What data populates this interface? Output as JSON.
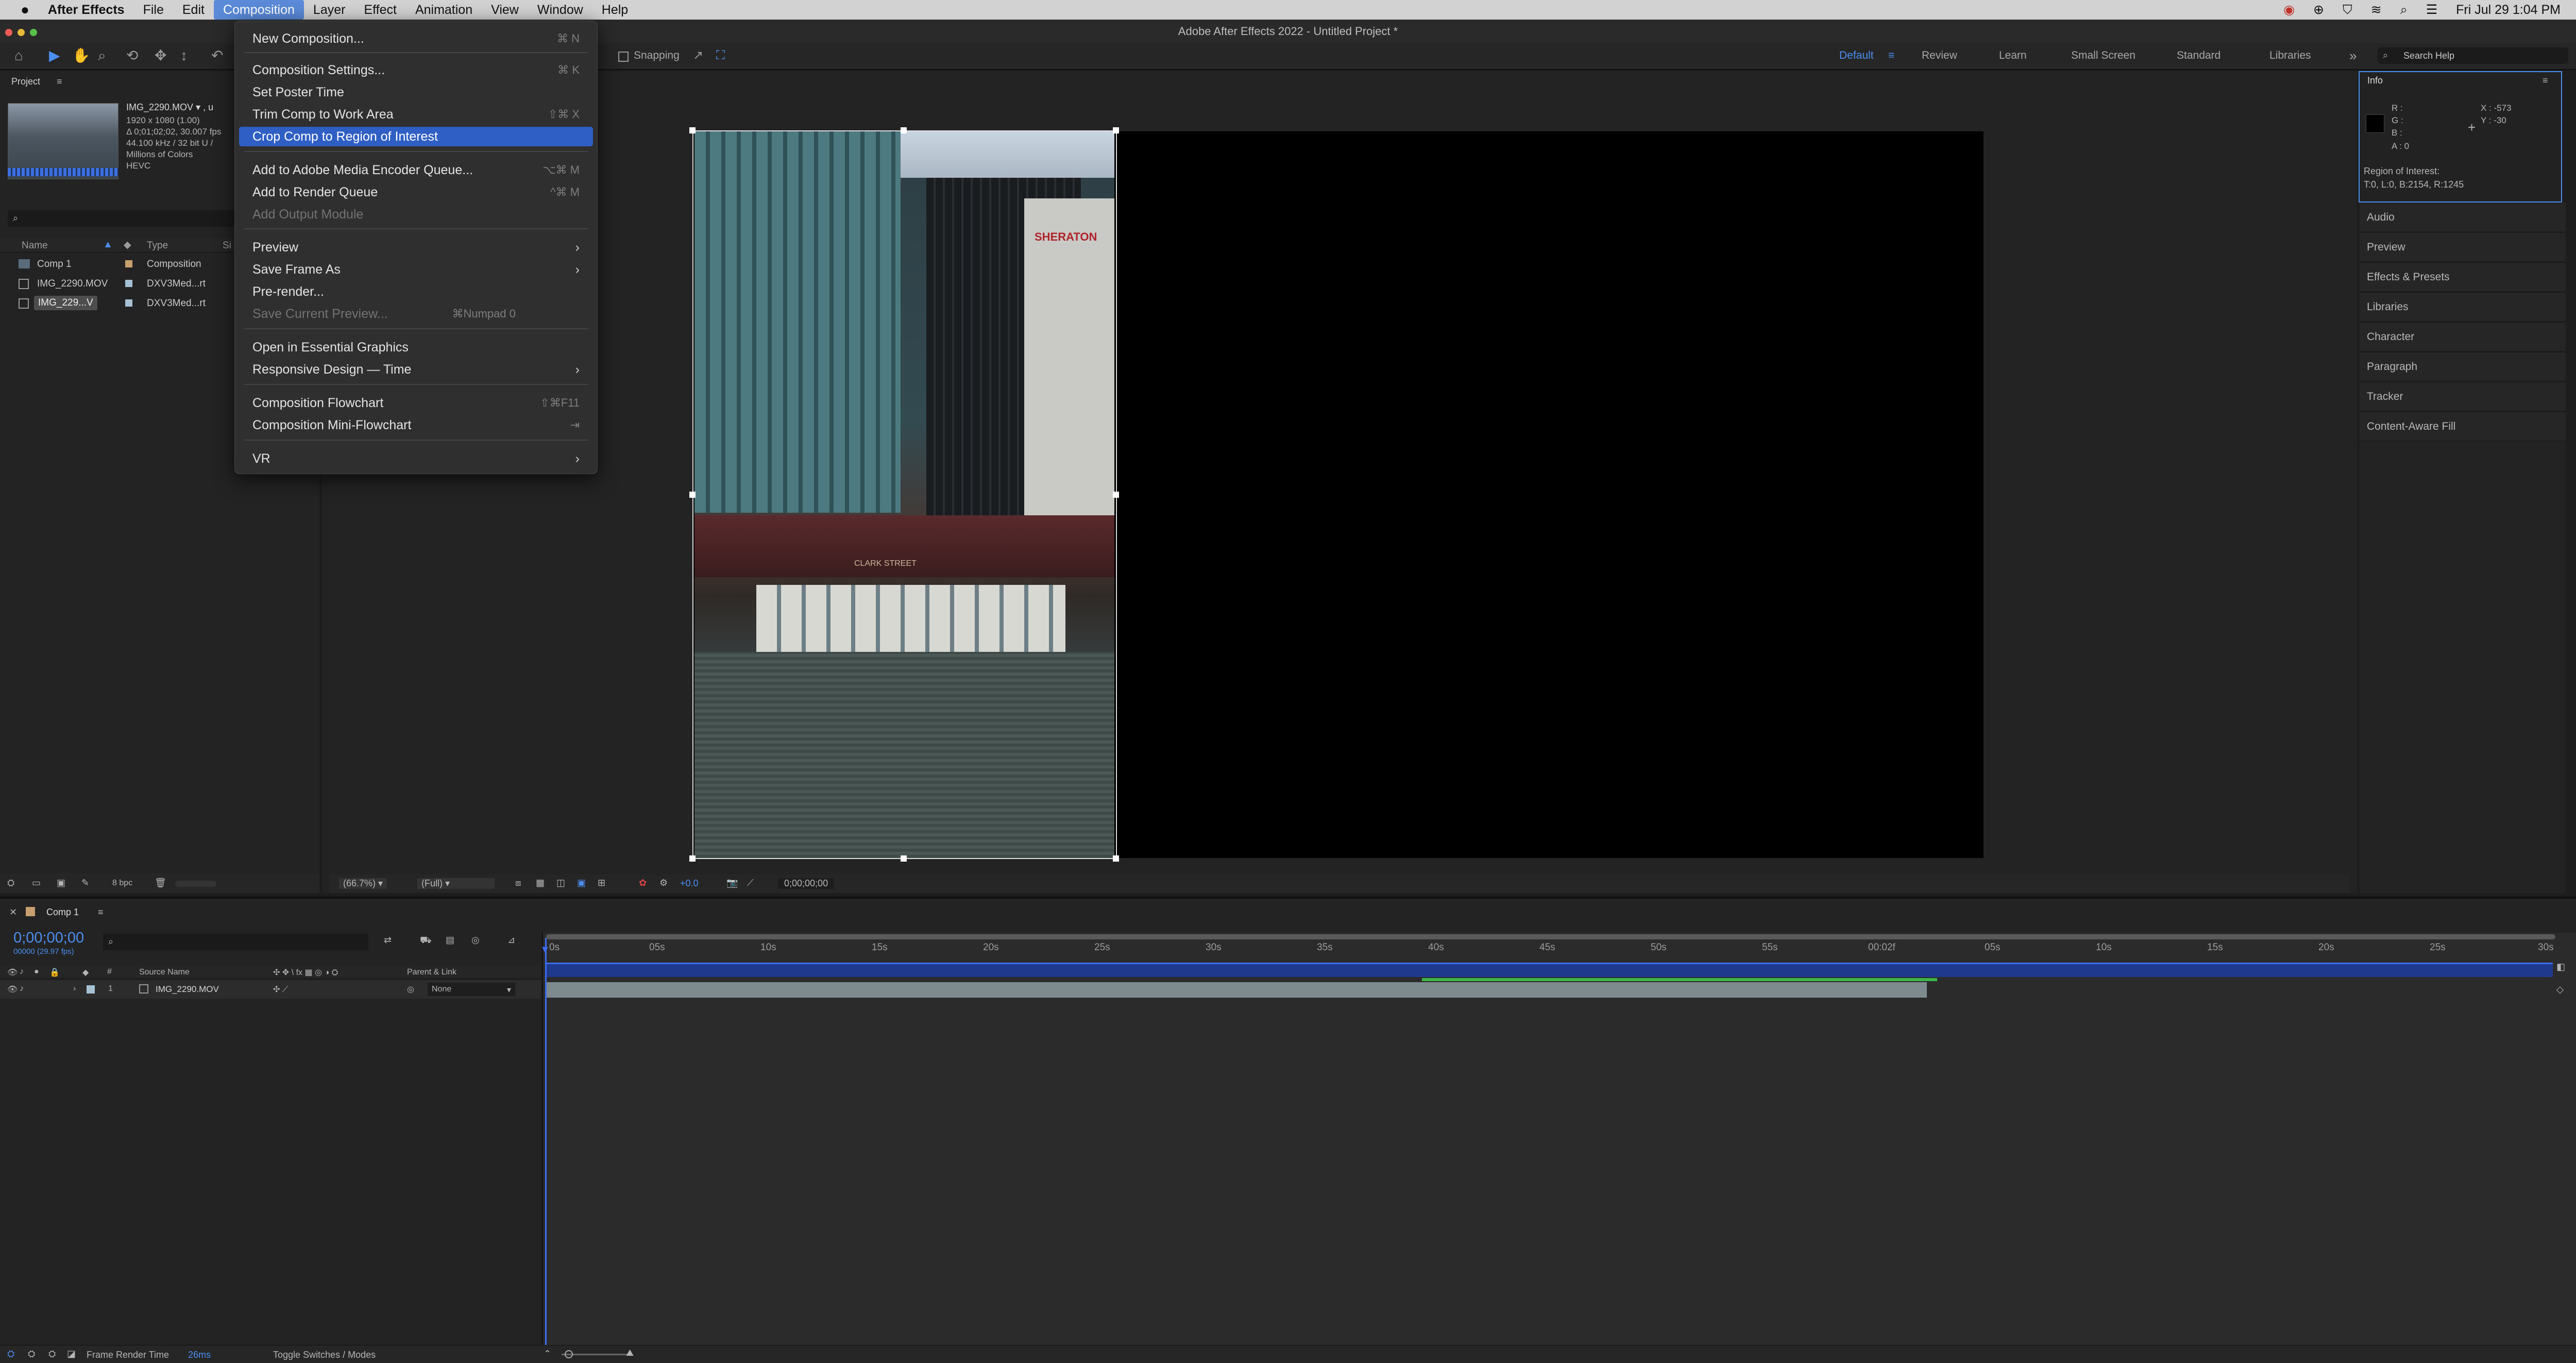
{
  "menubar": {
    "apple": "",
    "app": "After Effects",
    "items": [
      "File",
      "Edit",
      "Composition",
      "Layer",
      "Effect",
      "Animation",
      "View",
      "Window",
      "Help"
    ],
    "clock": "Fri Jul 29  1:04 PM"
  },
  "window": {
    "title": "Adobe After Effects 2022 - Untitled Project *"
  },
  "toolbar": {
    "snapping": "Snapping",
    "workspaces": [
      "Default",
      "Review",
      "Learn",
      "Small Screen",
      "Standard",
      "Libraries"
    ],
    "search_placeholder": "Search Help"
  },
  "project": {
    "title": "Project",
    "file_name": "IMG_2290.MOV ▾ , u",
    "info": [
      "1920 x 1080 (1.00)",
      "Δ 0;01;02;02, 30.007 fps",
      "HEVC",
      "Millions of Colors",
      "44.100 kHz / 32 bit U /"
    ],
    "columns": {
      "name": "Name",
      "type": "Type",
      "size": "Si"
    },
    "rows": [
      {
        "name": "Comp 1",
        "type": "Composition"
      },
      {
        "name": "IMG_2290.MOV",
        "type": "DXV3Med...rt"
      },
      {
        "name": "IMG_229...V",
        "type": "DXV3Med...rt"
      }
    ],
    "bpc": "8 bpc"
  },
  "menu": {
    "items": [
      {
        "label": "New Composition...",
        "shortcut": "⌘ N"
      },
      {
        "label": "Composition Settings...",
        "shortcut": "⌘ K"
      },
      {
        "label": "Set Poster Time",
        "shortcut": ""
      },
      {
        "label": "Trim Comp to Work Area",
        "shortcut": "⇧⌘ X"
      },
      {
        "label": "Crop Comp to Region of Interest",
        "shortcut": ""
      },
      {
        "label": "Add to Adobe Media Encoder Queue...",
        "shortcut": "⌥⌘ M"
      },
      {
        "label": "Add to Render Queue",
        "shortcut": "^⌘ M"
      },
      {
        "label": "Add Output Module",
        "shortcut": ""
      },
      {
        "label": "Preview",
        "shortcut": ""
      },
      {
        "label": "Save Frame As",
        "shortcut": ""
      },
      {
        "label": "Pre-render...",
        "shortcut": ""
      },
      {
        "label": "Save Current Preview...",
        "shortcut": "⌘Numpad 0"
      },
      {
        "label": "Open in Essential Graphics",
        "shortcut": ""
      },
      {
        "label": "Responsive Design — Time",
        "shortcut": ""
      },
      {
        "label": "Composition Flowchart",
        "shortcut": "⇧⌘F11"
      },
      {
        "label": "Composition Mini-Flowchart",
        "shortcut": "⇥"
      },
      {
        "label": "VR",
        "shortcut": ""
      }
    ]
  },
  "viewer": {
    "zoom": "(66.7%)",
    "resolution": "(Full)",
    "exposure": "+0.0",
    "timecode": "0;00;00;00",
    "building_sign": "SHERATON",
    "bridge_sign": "CLARK STREET"
  },
  "info": {
    "title": "Info",
    "r": "R :",
    "g": "G :",
    "b": "B :",
    "a": "A :  0",
    "x": "X : -573",
    "y": "Y : -30",
    "roi_label": "Region of Interest:",
    "roi_value": "T:0, L:0, B:2154, R:1245"
  },
  "right_panels": [
    "Audio",
    "Preview",
    "Effects & Presets",
    "Libraries",
    "Character",
    "Paragraph",
    "Tracker",
    "Content-Aware Fill"
  ],
  "timeline": {
    "tab": "Comp 1",
    "timecode": "0;00;00;00",
    "fps": "00000 (29.97 fps)",
    "columns": {
      "num": "#",
      "source": "Source Name",
      "parent": "Parent & Link"
    },
    "layer": {
      "num": "1",
      "name": "IMG_2290.MOV",
      "parent": "None"
    },
    "ticks": [
      "0s",
      "05s",
      "10s",
      "15s",
      "20s",
      "25s",
      "30s",
      "35s",
      "40s",
      "45s",
      "50s",
      "55s",
      "00:02f",
      "05s",
      "10s",
      "15s",
      "20s",
      "25s",
      "30s"
    ],
    "footer_label": "Frame Render Time",
    "footer_value": "26ms",
    "toggle": "Toggle Switches / Modes"
  }
}
